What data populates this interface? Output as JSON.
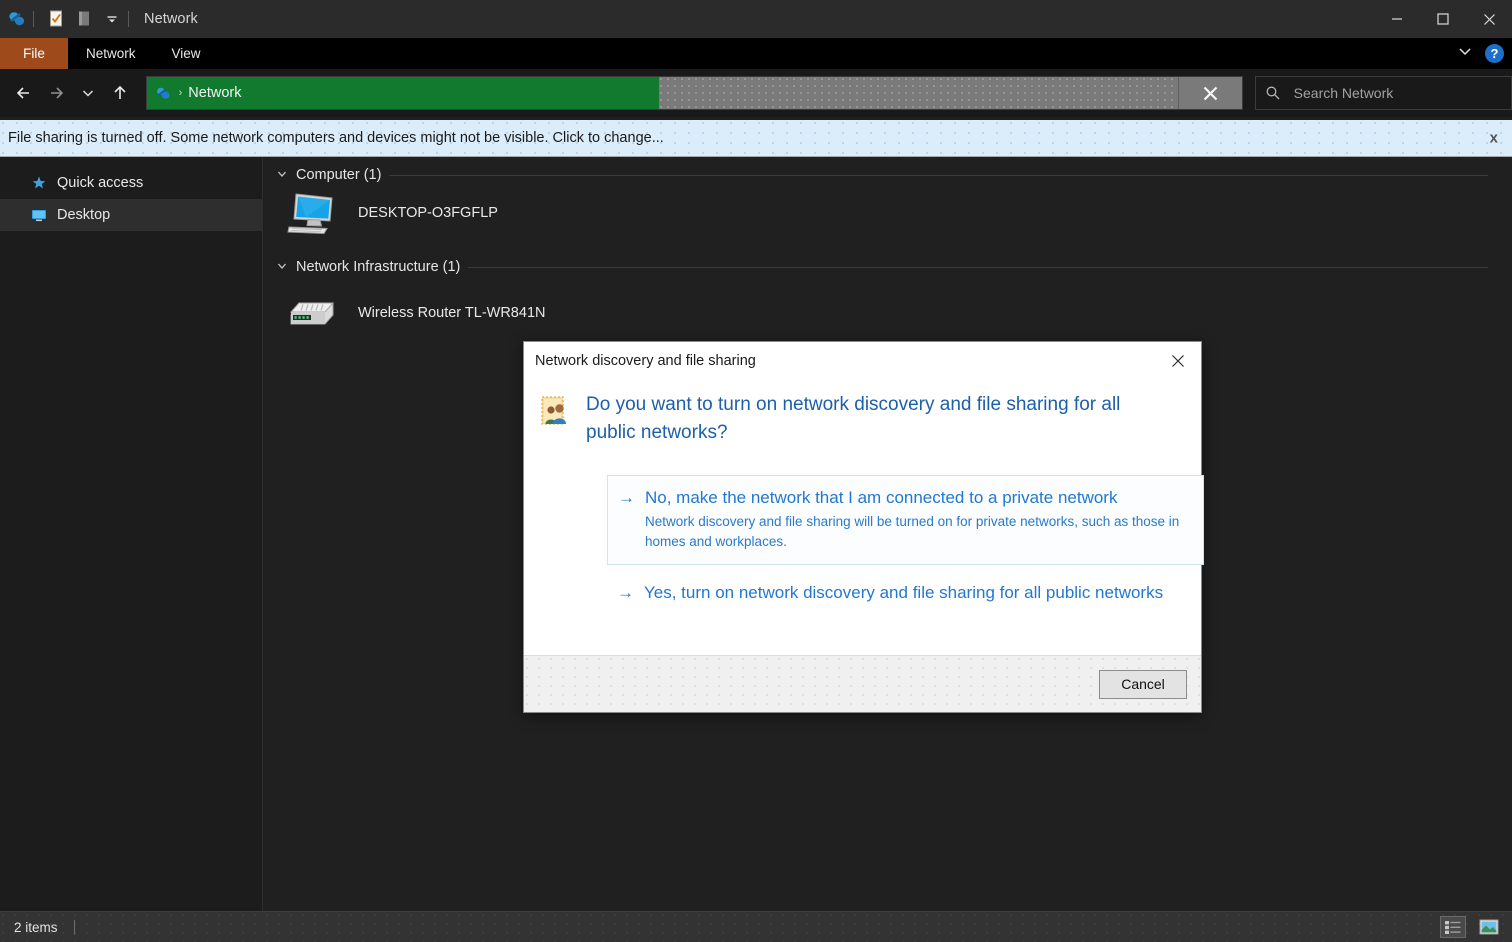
{
  "window": {
    "title": "Network",
    "app_icon": "network-icon",
    "quick_access_icons": [
      "properties-icon",
      "new-folder-icon",
      "customize-chevron-icon"
    ],
    "controls": {
      "minimize": "minimize-icon",
      "maximize": "maximize-icon",
      "close": "close-icon"
    }
  },
  "ribbon": {
    "file_tab": "File",
    "tabs": [
      "Network",
      "View"
    ],
    "collapse_icon": "chevron-down-icon",
    "help_label": "?",
    "file_tab_color": "#9e4a1b"
  },
  "navigation": {
    "back_icon": "arrow-left-icon",
    "forward_icon": "arrow-right-icon",
    "recent_icon": "chevron-down-icon",
    "up_icon": "arrow-up-icon",
    "address": {
      "icon": "network-icon",
      "separator": "›",
      "crumb": "Network",
      "progress_percent": 46,
      "progress_color": "#117a2f",
      "stop_refresh_icon": "stop-icon"
    },
    "search": {
      "icon": "search-icon",
      "placeholder": "Search Network",
      "value": ""
    }
  },
  "infobar": {
    "text": "File sharing is turned off. Some network computers and devices might not be visible. Click to change...",
    "close_label": "x",
    "background": "#dbedfa"
  },
  "sidebar": {
    "items": [
      {
        "label": "Quick access",
        "icon": "star-pin-icon",
        "selected": false
      },
      {
        "label": "Desktop",
        "icon": "desktop-icon",
        "selected": true
      }
    ]
  },
  "content": {
    "groups": [
      {
        "header": "Computer (1)",
        "items": [
          {
            "label": "DESKTOP-O3FGFLP",
            "icon": "computer-icon"
          }
        ]
      },
      {
        "header": "Network Infrastructure (1)",
        "items": [
          {
            "label": "Wireless Router TL-WR841N",
            "icon": "router-icon"
          }
        ]
      }
    ]
  },
  "statusbar": {
    "count": "2 items",
    "view_details_icon": "details-view-icon",
    "view_large_icons_icon": "large-icons-view-icon"
  },
  "dialog": {
    "title": "Network discovery and file sharing",
    "close_icon": "close-icon",
    "icon": "network-sharing-people-icon",
    "question": "Do you want to turn on network discovery and file sharing for all public networks?",
    "options": [
      {
        "arrow": "→",
        "main": "No, make the network that I am connected to a private network",
        "sub": "Network discovery and file sharing will be turned on for private networks, such as those in homes and workplaces.",
        "hovered": true
      },
      {
        "arrow": "→",
        "main": "Yes, turn on network discovery and file sharing for all public networks",
        "sub": "",
        "hovered": false
      }
    ],
    "cancel_label": "Cancel",
    "link_color": "#2278cf"
  }
}
